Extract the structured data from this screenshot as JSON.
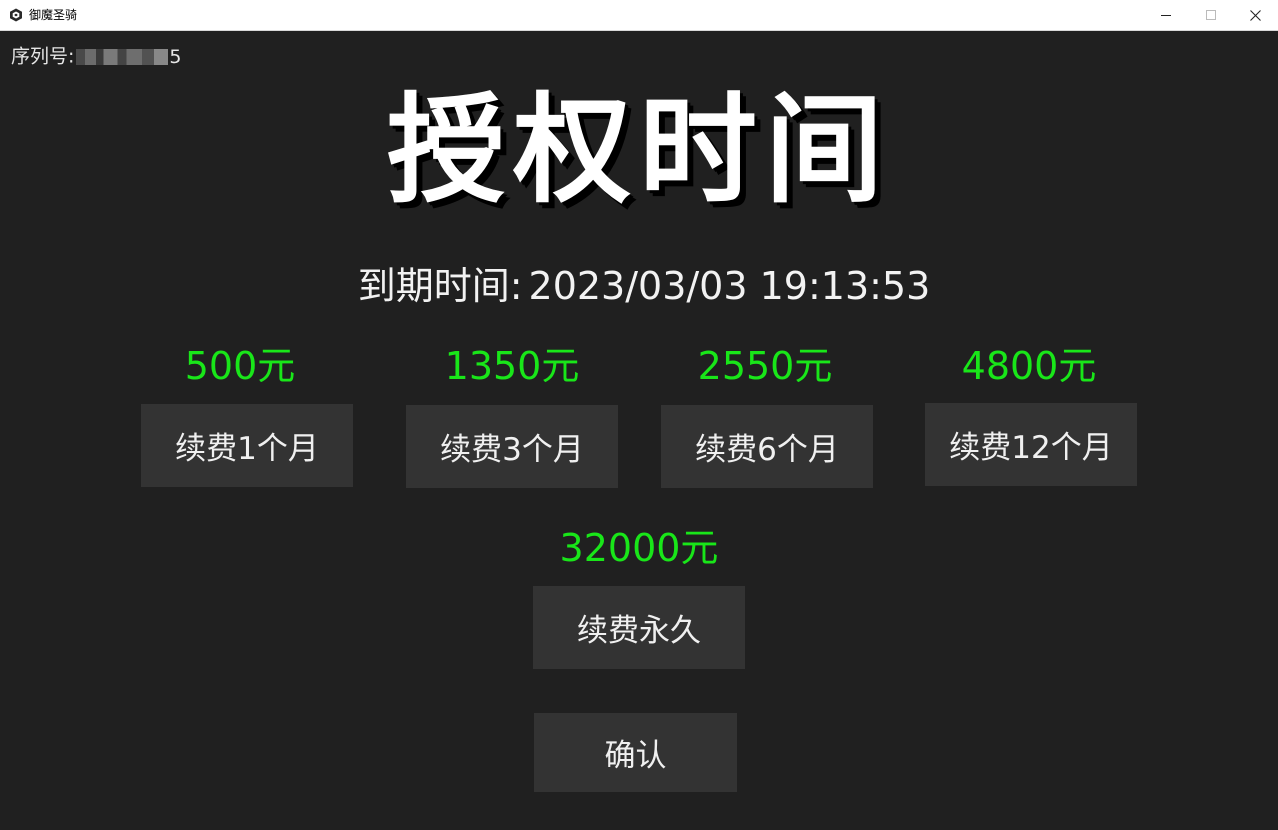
{
  "window": {
    "title": "御魔圣骑",
    "controls": [
      "minimize-icon",
      "maximize-icon",
      "close-icon"
    ]
  },
  "serial": {
    "label": "序列号:",
    "visible_suffix": "5"
  },
  "headline": "授权时间",
  "expiry": {
    "label": "到期时间:",
    "value": "2023/03/03 19:13:53"
  },
  "plans": [
    {
      "price": "500元",
      "button": "续费1个月"
    },
    {
      "price": "1350元",
      "button": "续费3个月"
    },
    {
      "price": "2550元",
      "button": "续费6个月"
    },
    {
      "price": "4800元",
      "button": "续费12个月"
    },
    {
      "price": "32000元",
      "button": "续费永久"
    }
  ],
  "confirm_label": "确认",
  "colors": {
    "background": "#202020",
    "button": "#333333",
    "price": "#19e619",
    "text": "#ffffff"
  }
}
